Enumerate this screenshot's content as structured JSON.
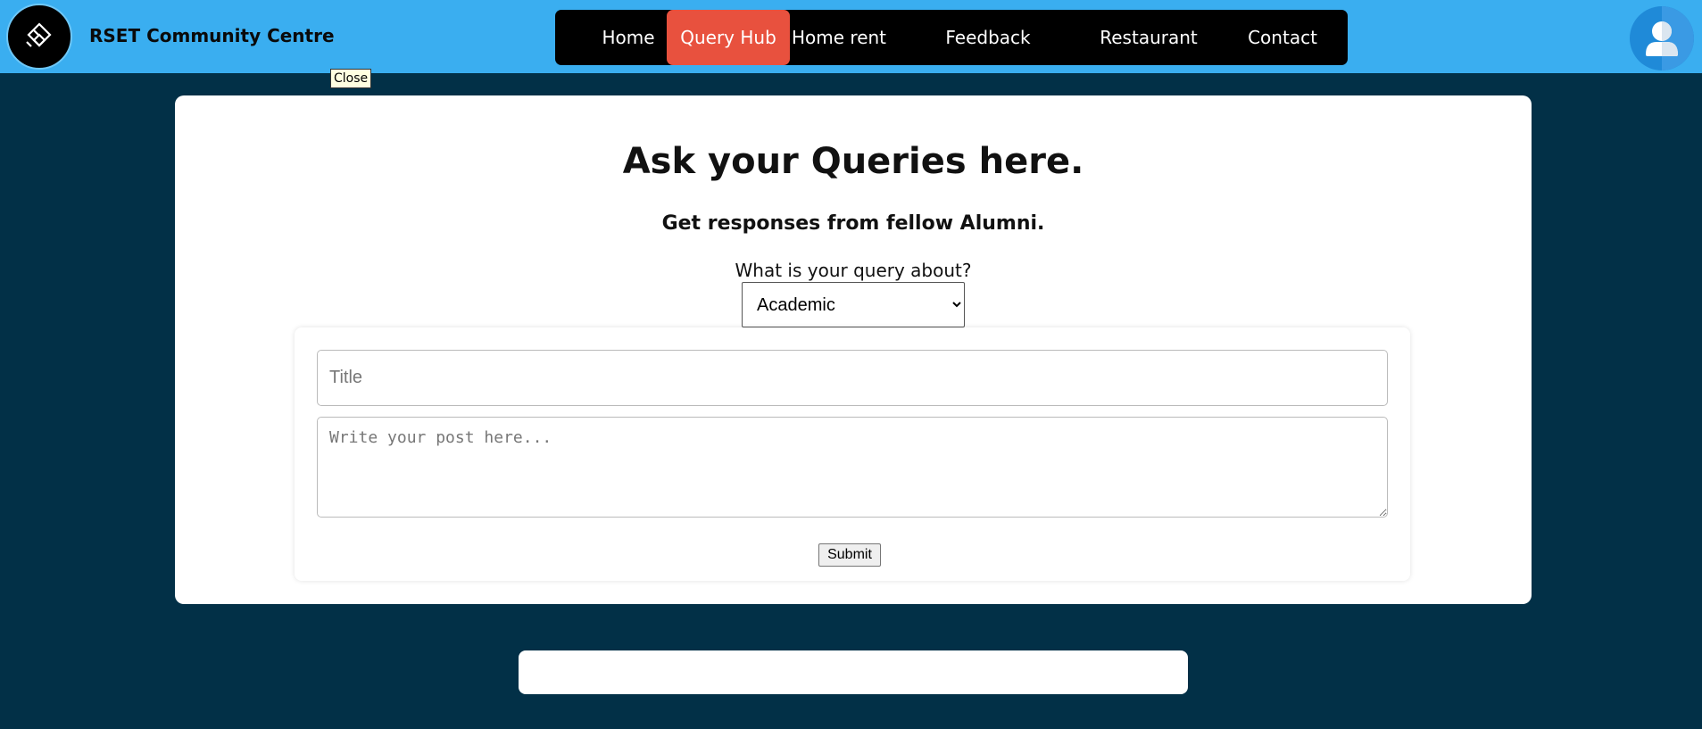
{
  "header": {
    "title": "RSET Community Centre",
    "logo_icon": "rset-logo-icon",
    "avatar_icon": "user-avatar-icon",
    "background_color": "#3aaef0"
  },
  "nav": {
    "items": [
      {
        "label": "Home",
        "active": false
      },
      {
        "label": "Query Hub",
        "active": true
      },
      {
        "label": "Home rent",
        "active": false
      },
      {
        "label": "Feedback",
        "active": false
      },
      {
        "label": "Restaurant",
        "active": false
      },
      {
        "label": "Contact",
        "active": false
      }
    ],
    "active_color": "#e8513e"
  },
  "tooltip": {
    "text": "Close"
  },
  "query_card": {
    "heading": "Ask your Queries here.",
    "subheading": "Get responses from fellow Alumni.",
    "category_label": "What is your query about?",
    "category_selected": "Academic",
    "title_placeholder": "Title",
    "post_placeholder": "Write your post here...",
    "submit_label": "Submit"
  },
  "page": {
    "background_color": "#023047"
  }
}
